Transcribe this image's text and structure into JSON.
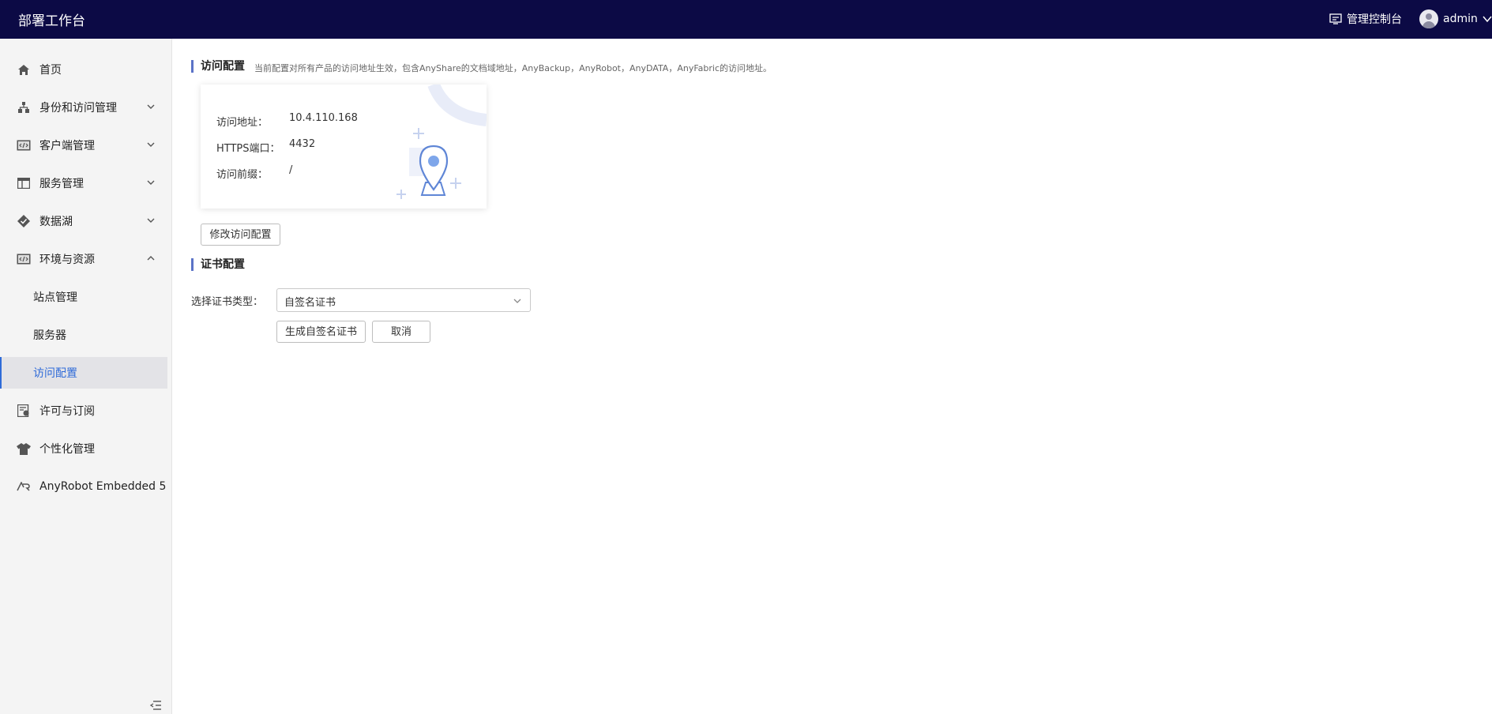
{
  "app": {
    "title": "部署工作台"
  },
  "header": {
    "console_label": "管理控制台",
    "console_icon": "monitor-icon",
    "user_name": "admin",
    "user_icon": "user-avatar-icon"
  },
  "sidebar": {
    "items": [
      {
        "label": "首页",
        "icon": "home-icon"
      },
      {
        "label": "身份和访问管理",
        "icon": "org-chart-icon",
        "expandable": true,
        "expanded": false
      },
      {
        "label": "客户端管理",
        "icon": "code-window-icon",
        "expandable": true,
        "expanded": false
      },
      {
        "label": "服务管理",
        "icon": "layout-icon",
        "expandable": true,
        "expanded": false
      },
      {
        "label": "数据湖",
        "icon": "diamond-check-icon",
        "expandable": true,
        "expanded": false
      },
      {
        "label": "环境与资源",
        "icon": "code-window-icon",
        "expandable": true,
        "expanded": true
      },
      {
        "label": "站点管理",
        "sub": true
      },
      {
        "label": "服务器",
        "sub": true
      },
      {
        "label": "访问配置",
        "sub": true,
        "active": true
      },
      {
        "label": "许可与订阅",
        "icon": "license-icon"
      },
      {
        "label": "个性化管理",
        "icon": "shirt-icon"
      },
      {
        "label": "AnyRobot Embedded 5",
        "icon": "anyrobot-logo-icon"
      }
    ],
    "collapse_icon": "collapse-menu-icon"
  },
  "access_config": {
    "title": "访问配置",
    "description": "当前配置对所有产品的访问地址生效，包含AnyShare的文档域地址，AnyBackup，AnyRobot，AnyDATA，AnyFabric的访问地址。",
    "address_label": "访问地址：",
    "address_value": "10.4.110.168",
    "https_port_label": "HTTPS端口：",
    "https_port_value": "4432",
    "prefix_label": "访问前缀：",
    "prefix_value": "/",
    "edit_button": "修改访问配置"
  },
  "cert_config": {
    "title": "证书配置",
    "type_label": "选择证书类型：",
    "type_value": "自签名证书",
    "generate_button": "生成自签名证书",
    "cancel_button": "取消"
  },
  "colors": {
    "header_bg": "#0c0a45",
    "accent": "#2f6bd8",
    "section_bar": "#5b73c7"
  }
}
